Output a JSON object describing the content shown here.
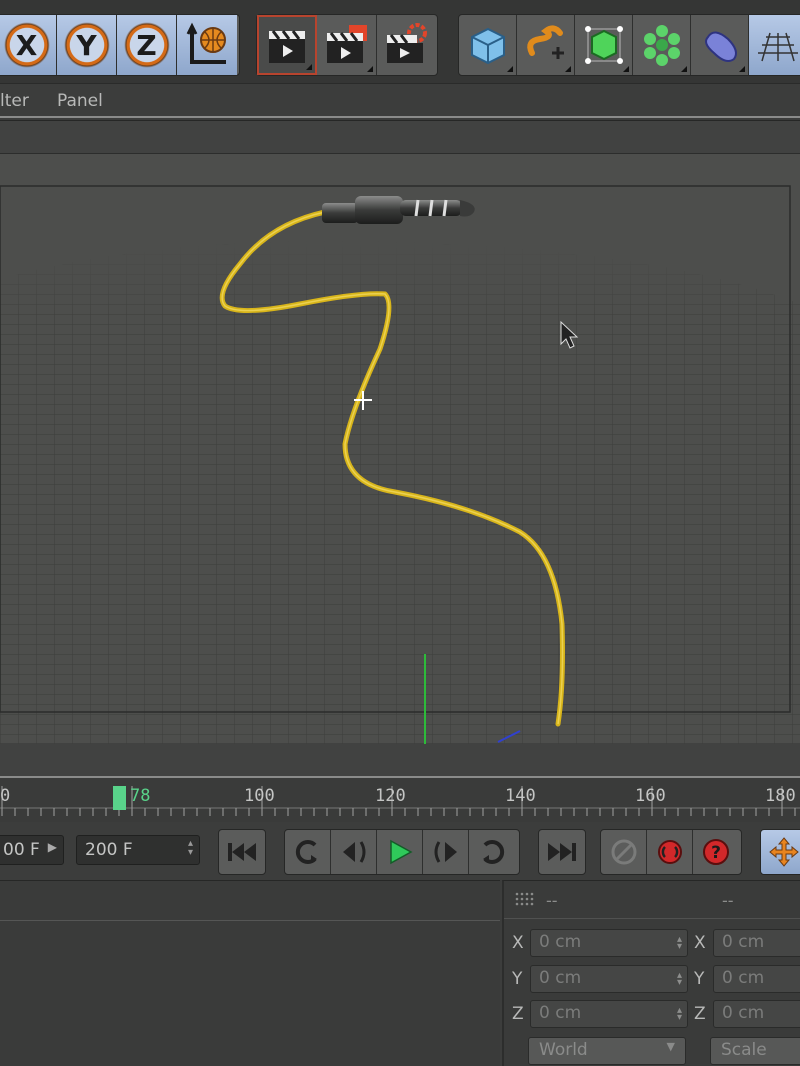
{
  "toolbar": {
    "axis_buttons": [
      "X",
      "Y",
      "Z"
    ],
    "icons": [
      "x-axis-lock-icon",
      "y-axis-lock-icon",
      "z-axis-lock-icon",
      "world-coordinates-icon",
      "render-view-icon",
      "render-active-view-icon",
      "render-settings-icon",
      "cube-primitive-icon",
      "spline-pen-icon",
      "subdivision-surface-icon",
      "cloner-icon",
      "deformer-icon",
      "floor-grid-icon"
    ]
  },
  "menu": {
    "items": [
      "lter",
      "Panel"
    ]
  },
  "timeline": {
    "ticks": [
      "0",
      "100",
      "120",
      "140",
      "160",
      "180"
    ],
    "current_frame": "78"
  },
  "transport": {
    "min_field": "00 F",
    "max_field": "200 F"
  },
  "coords": {
    "header_left": "--",
    "header_right": "--",
    "rows": [
      {
        "axis": "X",
        "value1": "0 cm",
        "axis2": "X",
        "value2": "0 cm"
      },
      {
        "axis": "Y",
        "value1": "0 cm",
        "axis2": "Y",
        "value2": "0 cm"
      },
      {
        "axis": "Z",
        "value1": "0 cm",
        "axis2": "Z",
        "value2": "0 cm"
      }
    ],
    "space_dropdown": "World",
    "mode_dropdown": "Scale"
  },
  "colors": {
    "cable": "#d8b51a",
    "timeline_marker": "#59d38a",
    "play": "#2fc95a",
    "record": "#d2282a"
  }
}
